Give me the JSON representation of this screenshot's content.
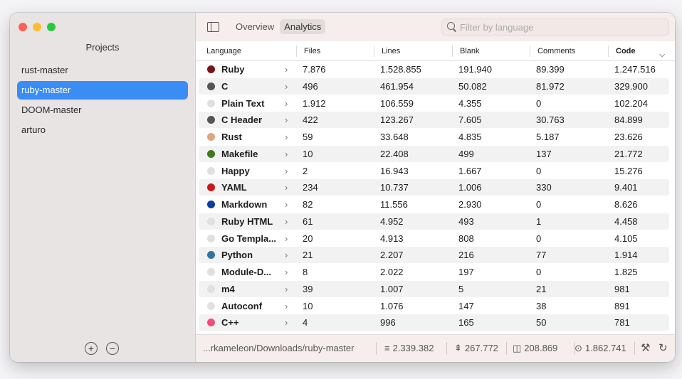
{
  "sidebar": {
    "title": "Projects",
    "projects": [
      {
        "label": "rust-master",
        "selected": false
      },
      {
        "label": "ruby-master",
        "selected": true
      },
      {
        "label": "DOOM-master",
        "selected": false
      },
      {
        "label": "arturo",
        "selected": false
      }
    ],
    "add_icon": "+",
    "remove_icon": "−"
  },
  "toolbar": {
    "tabs": [
      {
        "label": "Overview",
        "active": false
      },
      {
        "label": "Analytics",
        "active": true
      }
    ],
    "search_placeholder": "Filter by language"
  },
  "table": {
    "columns": [
      "Language",
      "Files",
      "Lines",
      "Blank",
      "Comments",
      "Code"
    ],
    "sorted_column": "Code",
    "rows": [
      {
        "color": "#7a1518",
        "language": "Ruby",
        "files": "7.876",
        "lines": "1.528.855",
        "blank": "191.940",
        "comments": "89.399",
        "code": "1.247.516"
      },
      {
        "color": "#555555",
        "language": "C",
        "files": "496",
        "lines": "461.954",
        "blank": "50.082",
        "comments": "81.972",
        "code": "329.900"
      },
      {
        "color": "#e0e0e0",
        "language": "Plain Text",
        "files": "1.912",
        "lines": "106.559",
        "blank": "4.355",
        "comments": "0",
        "code": "102.204"
      },
      {
        "color": "#555555",
        "language": "C Header",
        "files": "422",
        "lines": "123.267",
        "blank": "7.605",
        "comments": "30.763",
        "code": "84.899"
      },
      {
        "color": "#dea584",
        "language": "Rust",
        "files": "59",
        "lines": "33.648",
        "blank": "4.835",
        "comments": "5.187",
        "code": "23.626"
      },
      {
        "color": "#427819",
        "language": "Makefile",
        "files": "10",
        "lines": "22.408",
        "blank": "499",
        "comments": "137",
        "code": "21.772"
      },
      {
        "color": "#e0e0e0",
        "language": "Happy",
        "files": "2",
        "lines": "16.943",
        "blank": "1.667",
        "comments": "0",
        "code": "15.276"
      },
      {
        "color": "#cb171e",
        "language": "YAML",
        "files": "234",
        "lines": "10.737",
        "blank": "1.006",
        "comments": "330",
        "code": "9.401"
      },
      {
        "color": "#083fa1",
        "language": "Markdown",
        "files": "82",
        "lines": "11.556",
        "blank": "2.930",
        "comments": "0",
        "code": "8.626"
      },
      {
        "color": "#e0e0e0",
        "language": "Ruby HTML",
        "files": "61",
        "lines": "4.952",
        "blank": "493",
        "comments": "1",
        "code": "4.458"
      },
      {
        "color": "#e0e0e0",
        "language": "Go Templa...",
        "files": "20",
        "lines": "4.913",
        "blank": "808",
        "comments": "0",
        "code": "4.105"
      },
      {
        "color": "#3572a5",
        "language": "Python",
        "files": "21",
        "lines": "2.207",
        "blank": "216",
        "comments": "77",
        "code": "1.914"
      },
      {
        "color": "#e0e0e0",
        "language": "Module-D...",
        "files": "8",
        "lines": "2.022",
        "blank": "197",
        "comments": "0",
        "code": "1.825"
      },
      {
        "color": "#e0e0e0",
        "language": "m4",
        "files": "39",
        "lines": "1.007",
        "blank": "5",
        "comments": "21",
        "code": "981"
      },
      {
        "color": "#e0e0e0",
        "language": "Autoconf",
        "files": "10",
        "lines": "1.076",
        "blank": "147",
        "comments": "38",
        "code": "891"
      },
      {
        "color": "#f34b7d",
        "language": "C++",
        "files": "4",
        "lines": "996",
        "blank": "165",
        "comments": "50",
        "code": "781"
      }
    ]
  },
  "status": {
    "path": "...rkameleon/Downloads/ruby-master",
    "total_lines": "2.339.382",
    "total_blank": "267.772",
    "total_comments": "208.869",
    "total_code": "1.862.741"
  }
}
